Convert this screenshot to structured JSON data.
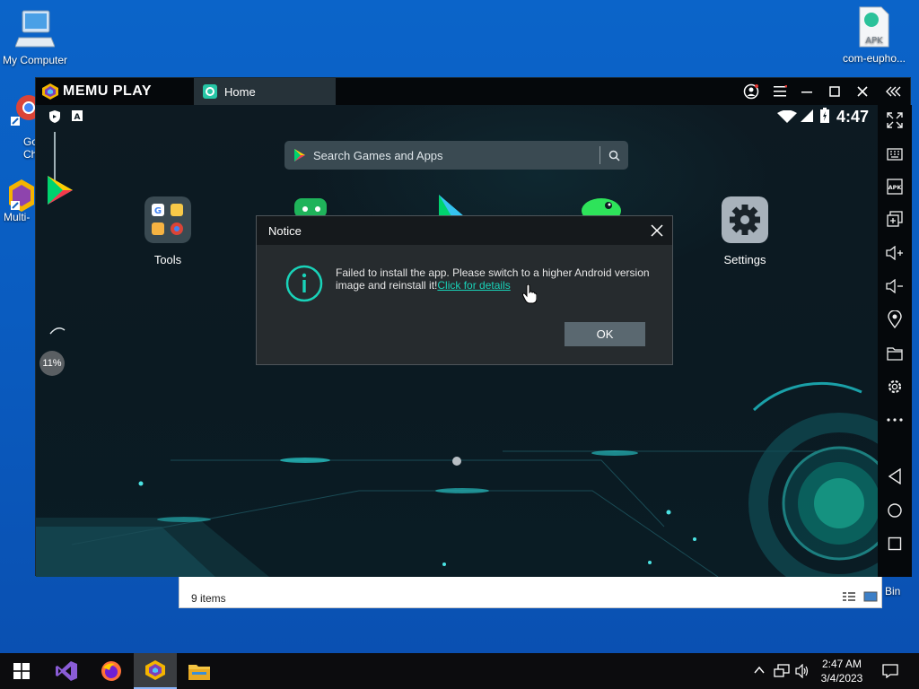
{
  "desktop": {
    "icons": {
      "my_computer": "My Computer",
      "apk_file": "com-eupho...",
      "chrome_partial_1": "Goo",
      "chrome_partial_2": "Chr",
      "multi_partial": "Multi-"
    },
    "recycle_bin_partial": "Bin"
  },
  "explorer": {
    "status": "9 items"
  },
  "memu": {
    "logo_text": "MEMU PLAY",
    "tab_label": "Home",
    "clock": "4:47",
    "search_placeholder": "Search Games and Apps",
    "apps": {
      "tools": "Tools",
      "settings": "Settings"
    },
    "progress_label": "11%",
    "progress_value": 11
  },
  "notice": {
    "title": "Notice",
    "message": "Failed to install the app. Please switch to a higher Android version image and reinstall it!",
    "link_text": "Click for details",
    "ok_label": "OK"
  },
  "taskbar": {
    "time": "2:47 AM",
    "date": "3/4/2023"
  },
  "colors": {
    "accent_teal": "#19d3b9",
    "desktop_blue": "#0b64c9"
  }
}
